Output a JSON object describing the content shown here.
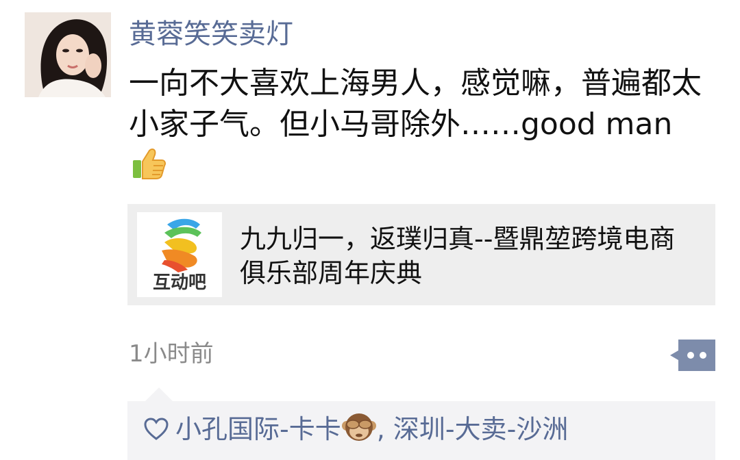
{
  "post": {
    "username": "黄蓉笑笑卖灯",
    "text": "一向不大喜欢上海男人，感觉嘛，普遍都太小家子气。但小马哥除外……good man",
    "text_icon": "thumbs-up-icon",
    "avatar_icon": "profile-photo"
  },
  "link_card": {
    "logo_label": "互动吧",
    "logo_icon": "hudong-hands-logo",
    "title": "九九归一，返璞归真--暨鼎堃跨境电商俱乐部周年庆典"
  },
  "footer": {
    "timestamp": "1小时前",
    "more_icon": "more-dots-icon"
  },
  "likes": {
    "icon": "heart-icon",
    "liker1": "小孔国际-卡卡",
    "liker1_icon": "see-no-evil-monkey-icon",
    "separator": ",",
    "liker2": "深圳-大卖-沙洲"
  },
  "colors": {
    "name_link": "#586b95",
    "card_bg": "#eeeeee",
    "likes_bg": "#f3f3f5",
    "timestamp": "#8a8a8a",
    "more_button": "#7d8cab"
  }
}
